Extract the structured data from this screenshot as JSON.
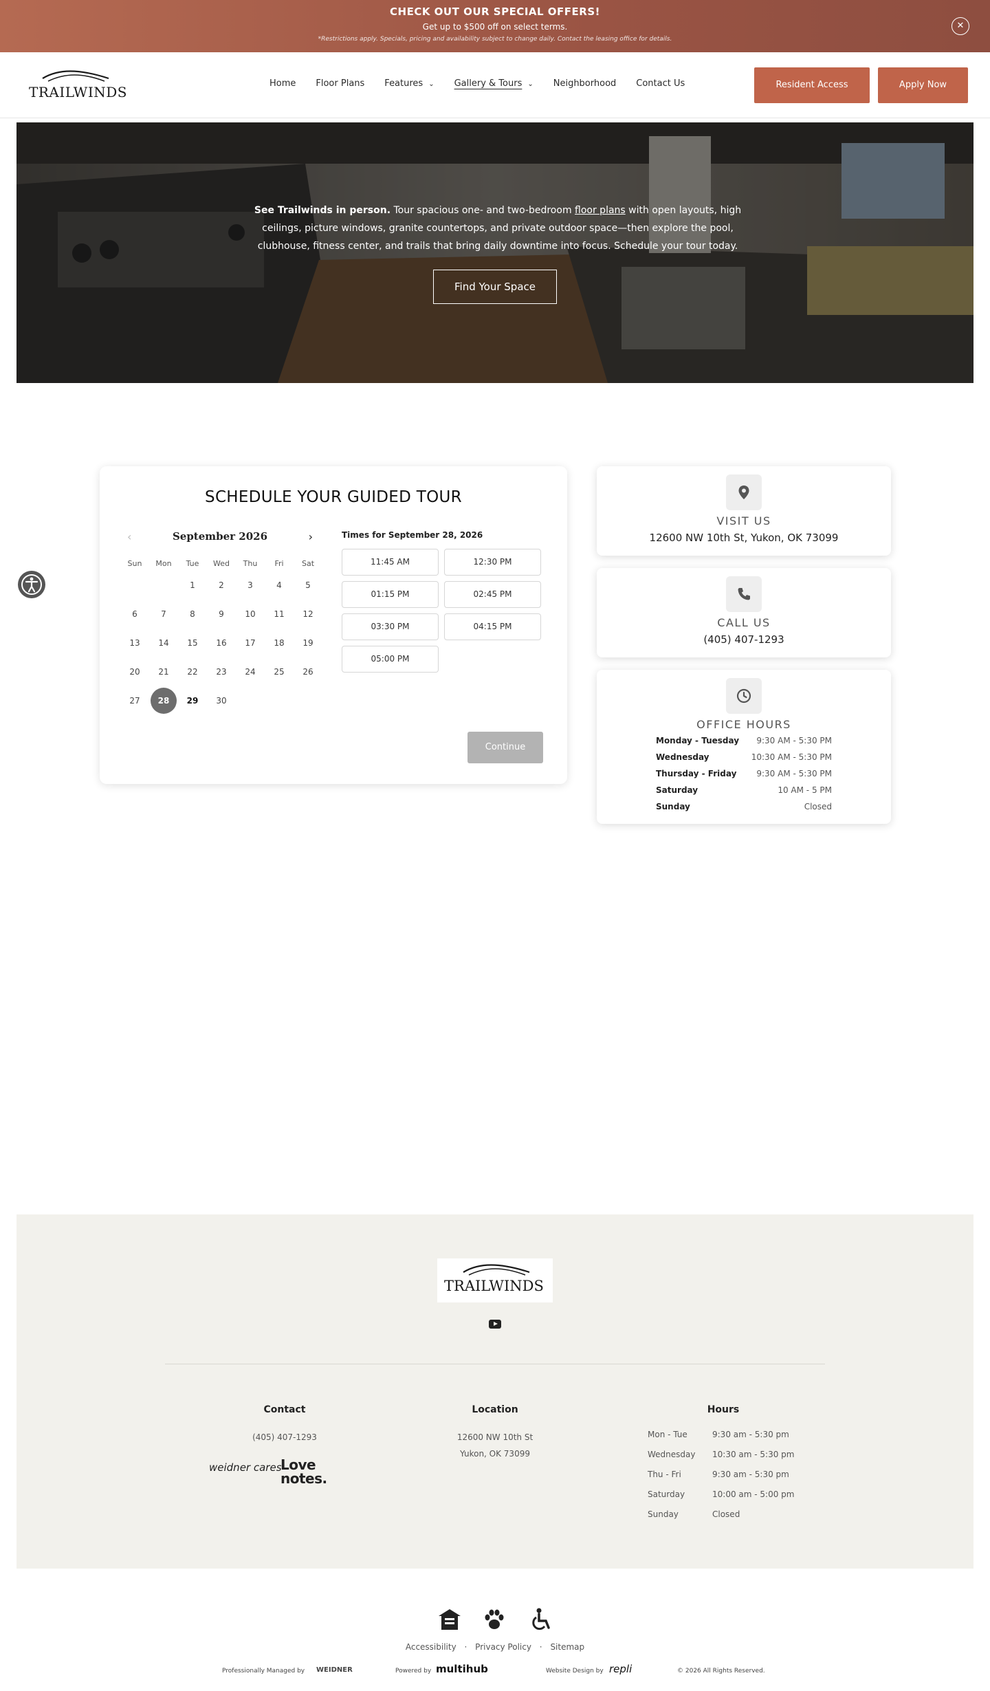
{
  "promo": {
    "title": "CHECK OUT OUR SPECIAL OFFERS!",
    "subtitle": "Get up to $500 off on select terms.",
    "disclaimer": "*Restrictions apply. Specials, pricing and availability subject to change daily. Contact the leasing office for details.",
    "close_icon": "close-icon"
  },
  "header": {
    "logo_text": "TRAILWINDS",
    "nav": [
      {
        "label": "Home"
      },
      {
        "label": "Floor Plans"
      },
      {
        "label": "Features",
        "dropdown": true
      },
      {
        "label": "Gallery & Tours",
        "dropdown": true,
        "active": true
      },
      {
        "label": "Neighborhood"
      },
      {
        "label": "Contact Us"
      }
    ],
    "resident_label": "Resident Access",
    "apply_label": "Apply Now",
    "accent_color": "#c0644a"
  },
  "hero": {
    "lead_bold": "See Trailwinds in person.",
    "text_before_link": " Tour spacious one- and two-bedroom ",
    "link_text": "floor plans",
    "text_after_link": " with open layouts, high ceilings, picture windows, granite countertops, and private outdoor space—then explore the pool, clubhouse, fitness center, and trails that bring daily downtime into focus. Schedule your tour today.",
    "cta_label": "Find Your Space"
  },
  "schedule": {
    "title": "SCHEDULE YOUR GUIDED TOUR",
    "month_label": "September 2026",
    "weekdays": [
      "Sun",
      "Mon",
      "Tue",
      "Wed",
      "Thu",
      "Fri",
      "Sat"
    ],
    "weeks": [
      [
        "",
        "",
        "1",
        "2",
        "3",
        "4",
        "5"
      ],
      [
        "6",
        "7",
        "8",
        "9",
        "10",
        "11",
        "12"
      ],
      [
        "13",
        "14",
        "15",
        "16",
        "17",
        "18",
        "19"
      ],
      [
        "20",
        "21",
        "22",
        "23",
        "24",
        "25",
        "26"
      ],
      [
        "27",
        "28",
        "29",
        "30",
        "",
        "",
        ""
      ]
    ],
    "selected_day": "28",
    "bold_day": "29",
    "times_title": "Times for September 28, 2026",
    "times": [
      "11:45 AM",
      "12:30 PM",
      "01:15 PM",
      "02:45 PM",
      "03:30 PM",
      "04:15 PM",
      "05:00 PM"
    ],
    "continue_label": "Continue"
  },
  "visit": {
    "label": "VISIT US",
    "value": "12600 NW 10th St, Yukon, OK 73099",
    "icon": "map-pin-icon"
  },
  "call": {
    "label": "CALL US",
    "value": "(405) 407-1293",
    "icon": "phone-icon"
  },
  "office": {
    "label": "OFFICE HOURS",
    "icon": "clock-icon",
    "rows": [
      {
        "day": "Monday - Tuesday",
        "hours": "9:30 AM - 5:30 PM"
      },
      {
        "day": "Wednesday",
        "hours": "10:30 AM - 5:30 PM"
      },
      {
        "day": "Thursday - Friday",
        "hours": "9:30 AM - 5:30 PM"
      },
      {
        "day": "Saturday",
        "hours": "10 AM - 5 PM"
      },
      {
        "day": "Sunday",
        "hours": "Closed"
      }
    ]
  },
  "footer": {
    "logo_text": "TRAILWINDS",
    "contact": {
      "heading": "Contact",
      "phone": "(405) 407-1293"
    },
    "location": {
      "heading": "Location",
      "line1": "12600 NW 10th St",
      "line2": "Yukon, OK 73099"
    },
    "hours": {
      "heading": "Hours",
      "rows": [
        {
          "day": "Mon - Tue",
          "hours": "9:30 am - 5:30 pm"
        },
        {
          "day": "Wednesday",
          "hours": "10:30 am - 5:30 pm"
        },
        {
          "day": "Thu - Fri",
          "hours": "9:30 am - 5:30 pm"
        },
        {
          "day": "Saturday",
          "hours": "10:00 am - 5:00 pm"
        },
        {
          "day": "Sunday",
          "hours": "Closed"
        }
      ]
    },
    "brand1": "weidner cares",
    "brand2": "Love notes."
  },
  "legal": {
    "links": [
      "Accessibility",
      "Privacy Policy",
      "Sitemap"
    ],
    "separator": "·",
    "managed_by": "Professionally Managed by",
    "managed_brand": "WEIDNER",
    "powered_by": "Powered by",
    "powered_brand": "multihub",
    "design_by": "Website Design by",
    "design_brand": "repli",
    "copyright": "© 2026 All Rights Reserved."
  }
}
